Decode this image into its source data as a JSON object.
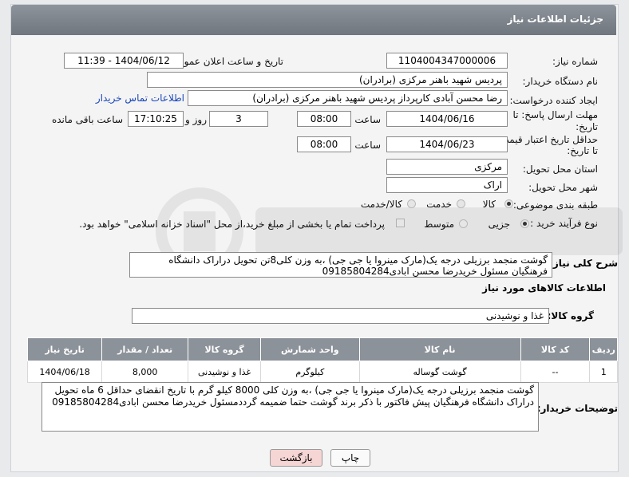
{
  "header": {
    "title": "جزئیات اطلاعات نیاز"
  },
  "fields": {
    "need_number_label": "شماره نیاز:",
    "need_number": "1104004347000006",
    "announce_label": "تاریخ و ساعت اعلان عمومی:",
    "announce_value": "1404/06/12 - 11:39",
    "buyer_org_label": "نام دستگاه خریدار:",
    "buyer_org": "پردیس شهید باهنر مرکزی (برادران)",
    "creator_label": "ایجاد کننده درخواست:",
    "creator": "رضا محسن آبادی کارپرداز پردیس شهید باهنر مرکزی (برادران)",
    "buyer_contact_link": "اطلاعات تماس خریدار",
    "reply_deadline_label_1": "مهلت ارسال پاسخ: تا",
    "reply_deadline_label_2": "تاریخ:",
    "reply_date": "1404/06/16",
    "time_label": "ساعت",
    "reply_time": "08:00",
    "days": "3",
    "days_label": "روز و",
    "remaining_time": "17:10:25",
    "remaining_label": "ساعت باقی مانده",
    "price_validity_label_1": "حداقل تاریخ اعتبار قیمت:",
    "price_validity_label_2": "تا تاریخ:",
    "validity_date": "1404/06/23",
    "validity_time": "08:00",
    "province_label": "استان محل تحویل:",
    "province": "مرکزی",
    "city_label": "شهر محل تحویل:",
    "city": "اراک",
    "category_label": "طبقه بندی موضوعی:",
    "category_options": [
      "کالا",
      "خدمت",
      "کالا/خدمت"
    ],
    "process_label": "نوع فرآیند خرید :",
    "process_options": [
      "جزیی",
      "متوسط"
    ],
    "payment_note": "پرداخت تمام یا بخشی از مبلغ خرید،از محل \"اسناد خزانه اسلامی\" خواهد بود."
  },
  "description": {
    "label": "شرح کلی نیاز:",
    "text": "گوشت منجمد برزیلی درجه یک(مارک مینروا یا جی جی) ،به وزن کلی8تن تحویل دراراک دانشگاه فرهنگیان مسئول خریدرضا محسن ابادی09185804284"
  },
  "goods_section": {
    "title": "اطلاعات کالاهای مورد نیاز",
    "group_label": "گروه کالا:",
    "group_value": "غذا و نوشیدنی"
  },
  "table": {
    "headers": [
      "ردیف",
      "کد کالا",
      "نام کالا",
      "واحد شمارش",
      "گروه کالا",
      "تعداد / مقدار",
      "تاریخ نیاز"
    ],
    "rows": [
      [
        "1",
        "--",
        "گوشت گوساله",
        "کیلوگرم",
        "غذا و نوشیدنی",
        "8,000",
        "1404/06/18"
      ]
    ]
  },
  "buyer_notes": {
    "label": "توضیحات خریدار:",
    "text": "گوشت منجمد برزیلی درجه یک(مارک مینروا یا جی جی) ،به وزن کلی 8000 کیلو گرم با تاریخ انقضای حداقل 6 ماه تحویل دراراک دانشگاه فرهنگیان پیش فاکتور با ذکر برند گوشت حتما ضمیمه گرددمسئول خریدرضا محسن ابادی09185804284"
  },
  "buttons": {
    "print": "چاپ",
    "back": "بازگشت"
  },
  "colors": {
    "header": "#7c8189",
    "link": "#1a47b8",
    "back_button": "#f6d5d5"
  }
}
